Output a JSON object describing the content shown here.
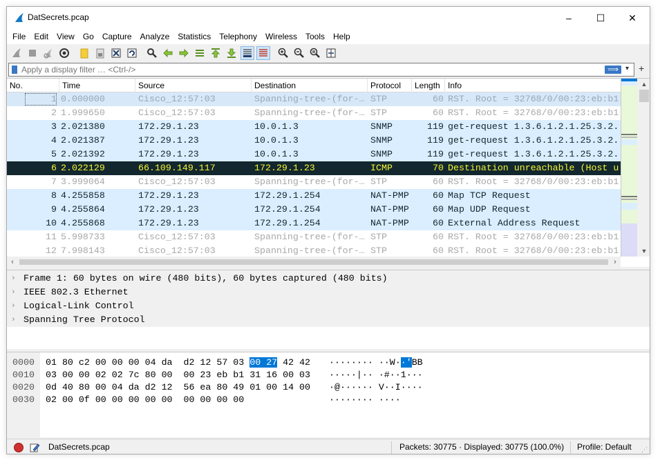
{
  "window": {
    "title": "DatSecrets.pcap",
    "minimize": "–",
    "maximize": "☐",
    "close": "✕"
  },
  "menu": [
    "File",
    "Edit",
    "View",
    "Go",
    "Capture",
    "Analyze",
    "Statistics",
    "Telephony",
    "Wireless",
    "Tools",
    "Help"
  ],
  "filter": {
    "placeholder": "Apply a display filter … <Ctrl-/>",
    "apply_glyph": "⟹",
    "dropdown_glyph": "▾",
    "add_glyph": "+"
  },
  "columns": {
    "no": "No.",
    "time": "Time",
    "source": "Source",
    "destination": "Destination",
    "protocol": "Protocol",
    "length": "Length",
    "info": "Info"
  },
  "packets": [
    {
      "no": "1",
      "time": "0.000000",
      "source": "Cisco_12:57:03",
      "destination": "Spanning-tree-(for-…",
      "protocol": "STP",
      "length": "60",
      "info": "RST. Root = 32768/0/00:23:eb:b1",
      "kind": "stp-selected"
    },
    {
      "no": "2",
      "time": "1.999650",
      "source": "Cisco_12:57:03",
      "destination": "Spanning-tree-(for-…",
      "protocol": "STP",
      "length": "60",
      "info": "RST. Root = 32768/0/00:23:eb:b1",
      "kind": "stp"
    },
    {
      "no": "3",
      "time": "2.021380",
      "source": "172.29.1.23",
      "destination": "10.0.1.3",
      "protocol": "SNMP",
      "length": "119",
      "info": "get-request 1.3.6.1.2.1.25.3.2.",
      "kind": "udp"
    },
    {
      "no": "4",
      "time": "2.021387",
      "source": "172.29.1.23",
      "destination": "10.0.1.3",
      "protocol": "SNMP",
      "length": "119",
      "info": "get-request 1.3.6.1.2.1.25.3.2.",
      "kind": "udp"
    },
    {
      "no": "5",
      "time": "2.021392",
      "source": "172.29.1.23",
      "destination": "10.0.1.3",
      "protocol": "SNMP",
      "length": "119",
      "info": "get-request 1.3.6.1.2.1.25.3.2.",
      "kind": "udp"
    },
    {
      "no": "6",
      "time": "2.022129",
      "source": "66.109.149.117",
      "destination": "172.29.1.23",
      "protocol": "ICMP",
      "length": "70",
      "info": "Destination unreachable (Host u",
      "kind": "icmp"
    },
    {
      "no": "7",
      "time": "3.999064",
      "source": "Cisco_12:57:03",
      "destination": "Spanning-tree-(for-…",
      "protocol": "STP",
      "length": "60",
      "info": "RST. Root = 32768/0/00:23:eb:b1",
      "kind": "stp"
    },
    {
      "no": "8",
      "time": "4.255858",
      "source": "172.29.1.23",
      "destination": "172.29.1.254",
      "protocol": "NAT-PMP",
      "length": "60",
      "info": "Map TCP Request",
      "kind": "udp"
    },
    {
      "no": "9",
      "time": "4.255864",
      "source": "172.29.1.23",
      "destination": "172.29.1.254",
      "protocol": "NAT-PMP",
      "length": "60",
      "info": "Map UDP Request",
      "kind": "udp"
    },
    {
      "no": "10",
      "time": "4.255868",
      "source": "172.29.1.23",
      "destination": "172.29.1.254",
      "protocol": "NAT-PMP",
      "length": "60",
      "info": "External Address Request",
      "kind": "udp"
    },
    {
      "no": "11",
      "time": "5.998733",
      "source": "Cisco_12:57:03",
      "destination": "Spanning-tree-(for-…",
      "protocol": "STP",
      "length": "60",
      "info": "RST. Root = 32768/0/00:23:eb:b1",
      "kind": "stp"
    },
    {
      "no": "12",
      "time": "7.998143",
      "source": "Cisco_12:57:03",
      "destination": "Spanning-tree-(for-…",
      "protocol": "STP",
      "length": "60",
      "info": "RST. Root = 32768/0/00:23:eb:b1",
      "kind": "stp"
    }
  ],
  "details": [
    "Frame 1: 60 bytes on wire (480 bits), 60 bytes captured (480 bits)",
    "IEEE 802.3 Ethernet",
    "Logical-Link Control",
    "Spanning Tree Protocol"
  ],
  "details_expander": "›",
  "bytes": [
    {
      "offset": "0000",
      "hex_a": "01 80 c2 00 00 00 04 da  d2 12 57 03 ",
      "hex_hl": "00 27",
      "hex_b": " 42 42",
      "ascii_a": "········ ··W·",
      "ascii_hl": "·'",
      "ascii_b": "BB"
    },
    {
      "offset": "0010",
      "hex_a": "03 00 00 02 02 7c 80 00  00 23 eb b1 31 16 00 03",
      "hex_hl": "",
      "hex_b": "",
      "ascii_a": "·····|·· ·#··1···",
      "ascii_hl": "",
      "ascii_b": ""
    },
    {
      "offset": "0020",
      "hex_a": "0d 40 80 00 04 da d2 12  56 ea 80 49 01 00 14 00",
      "hex_hl": "",
      "hex_b": "",
      "ascii_a": "·@······ V··I····",
      "ascii_hl": "",
      "ascii_b": ""
    },
    {
      "offset": "0030",
      "hex_a": "02 00 0f 00 00 00 00 00  00 00 00 00",
      "hex_hl": "",
      "hex_b": "",
      "ascii_a": "········ ····",
      "ascii_hl": "",
      "ascii_b": ""
    }
  ],
  "status": {
    "file": "DatSecrets.pcap",
    "stats": "Packets: 30775 · Displayed: 30775 (100.0%)",
    "profile": "Profile: Default"
  },
  "colors": {
    "stp_fg": "#a8a8a8",
    "udp_bg": "#daeeff",
    "icmp_bg": "#12272e",
    "icmp_fg": "#f7f632",
    "selection": "#0078d7",
    "accent": "#3a78c4"
  }
}
